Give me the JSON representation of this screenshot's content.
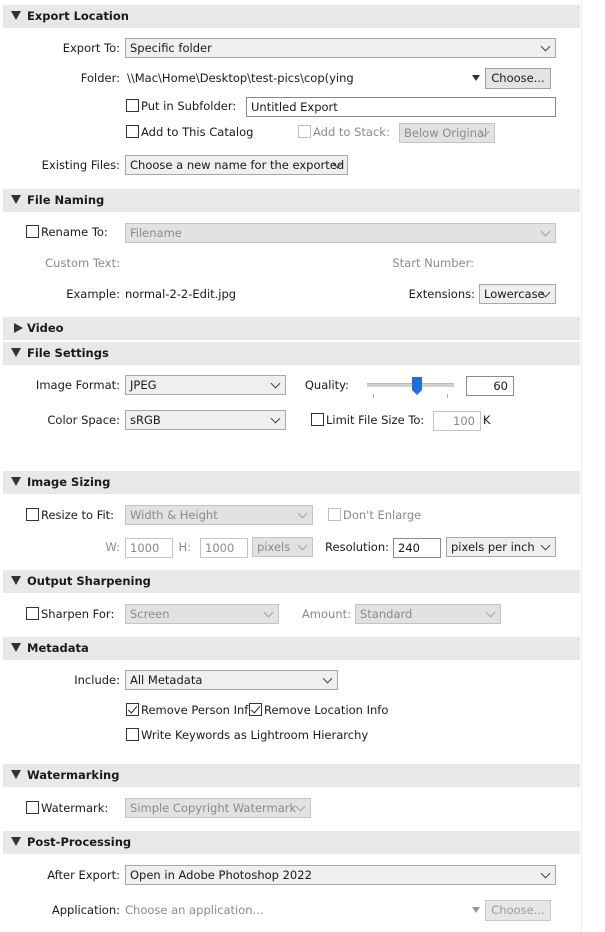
{
  "export_location": {
    "title": "Export Location",
    "export_to_label": "Export To:",
    "export_to_value": "Specific folder",
    "folder_label": "Folder:",
    "folder_path": "\\\\Mac\\Home\\Desktop\\test-pics\\cop(ying",
    "choose_label": "Choose...",
    "put_in_subfolder_label": "Put in Subfolder:",
    "subfolder_value": "Untitled Export",
    "add_to_catalog_label": "Add to This Catalog",
    "add_to_stack_label": "Add to Stack:",
    "stack_value": "Below Original",
    "existing_files_label": "Existing Files:",
    "existing_files_value": "Choose a new name for the exported file"
  },
  "file_naming": {
    "title": "File Naming",
    "rename_to_label": "Rename To:",
    "rename_value": "Filename",
    "custom_text_label": "Custom Text:",
    "start_number_label": "Start Number:",
    "example_label": "Example:",
    "example_value": "normal-2-2-Edit.jpg",
    "extensions_label": "Extensions:",
    "extensions_value": "Lowercase"
  },
  "video": {
    "title": "Video"
  },
  "file_settings": {
    "title": "File Settings",
    "image_format_label": "Image Format:",
    "image_format_value": "JPEG",
    "quality_label": "Quality:",
    "quality_value": "60",
    "quality_level": 0.6,
    "color_space_label": "Color Space:",
    "color_space_value": "sRGB",
    "limit_file_size_label": "Limit File Size To:",
    "limit_value": "100",
    "limit_unit": "K"
  },
  "image_sizing": {
    "title": "Image Sizing",
    "resize_label": "Resize to Fit:",
    "resize_value": "Width & Height",
    "dont_enlarge_label": "Don't Enlarge",
    "w_label": "W:",
    "w_value": "1000",
    "h_label": "H:",
    "h_value": "1000",
    "units_value": "pixels",
    "resolution_label": "Resolution:",
    "resolution_value": "240",
    "resolution_units": "pixels per inch"
  },
  "output_sharpening": {
    "title": "Output Sharpening",
    "sharpen_for_label": "Sharpen For:",
    "sharpen_value": "Screen",
    "amount_label": "Amount:",
    "amount_value": "Standard"
  },
  "metadata": {
    "title": "Metadata",
    "include_label": "Include:",
    "include_value": "All Metadata",
    "remove_person_label": "Remove Person Info",
    "remove_location_label": "Remove Location Info",
    "write_keywords_label": "Write Keywords as Lightroom Hierarchy"
  },
  "watermarking": {
    "title": "Watermarking",
    "watermark_label": "Watermark:",
    "watermark_value": "Simple Copyright Watermark"
  },
  "post_processing": {
    "title": "Post-Processing",
    "after_export_label": "After Export:",
    "after_export_value": "Open in Adobe Photoshop 2022",
    "application_label": "Application:",
    "application_placeholder": "Choose an application...",
    "choose_label": "Choose..."
  }
}
